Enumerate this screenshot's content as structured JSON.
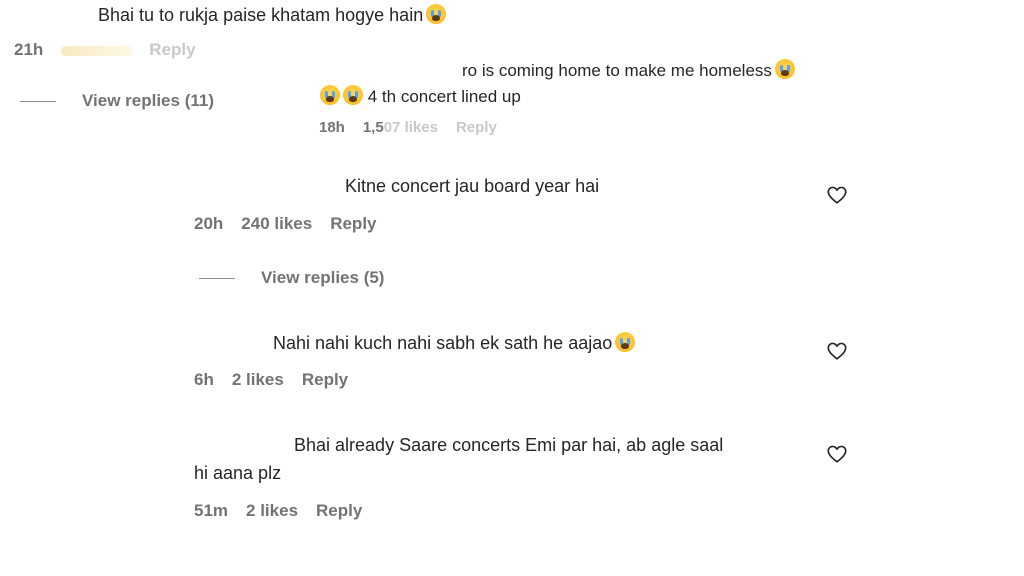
{
  "comments": [
    {
      "text": "Bhai tu to rukja paise khatam hogye hain",
      "time": "21h",
      "likes": "",
      "reply": "Reply",
      "view_replies": "View replies (11)"
    },
    {
      "text_line1": "ro is coming home to make me homeless",
      "text_line2": "4 th concert lined up",
      "time": "18h",
      "likes": "1,5",
      "likes_faded": "07 likes",
      "reply": "Reply"
    },
    {
      "text": "Kitne concert jau board year hai",
      "time": "20h",
      "likes": "240 likes",
      "reply": "Reply",
      "view_replies": "View replies (5)"
    },
    {
      "text": "Nahi nahi kuch nahi sabh ek sath he aajao",
      "time": "6h",
      "likes": "2 likes",
      "reply": "Reply"
    },
    {
      "text_line1": "Bhai already Saare concerts Emi par hai, ab agle saal",
      "text_line2": "hi aana plz",
      "time": "51m",
      "likes": "2 likes",
      "reply": "Reply"
    }
  ],
  "icons": {
    "emoji": "loudly-crying-face-icon",
    "heart": "heart-outline-icon"
  }
}
